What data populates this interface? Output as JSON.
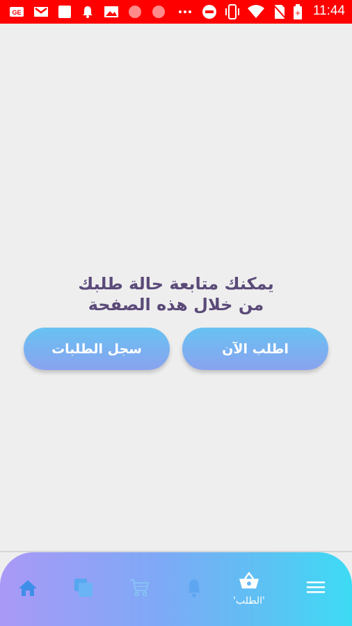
{
  "status_bar": {
    "background": "#ff0000",
    "time": "11:44",
    "icons": [
      "ge-icon",
      "gmail-icon",
      "square-icon",
      "bell-icon",
      "image-icon",
      "circle-icon",
      "circle-icon",
      "more-icon",
      "do-not-disturb-icon",
      "vibrate-icon",
      "wifi-icon",
      "no-sim-icon",
      "battery-charging-icon"
    ]
  },
  "message": {
    "line1": "يمكنك متابعة حالة طلبك",
    "line2": "من خلال هذه الصفحة",
    "color": "#5a4a79"
  },
  "buttons": {
    "order_now": "اطلب الآن",
    "order_history": "سجل الطلبات"
  },
  "bottom_nav": {
    "items": [
      {
        "icon": "menu-icon",
        "label": ""
      },
      {
        "icon": "basket-icon",
        "label": "'الطلب'",
        "active": true
      },
      {
        "icon": "bell-icon",
        "label": ""
      },
      {
        "icon": "cart-icon",
        "label": ""
      },
      {
        "icon": "copy-icon",
        "label": ""
      },
      {
        "icon": "home-icon",
        "label": ""
      }
    ]
  }
}
